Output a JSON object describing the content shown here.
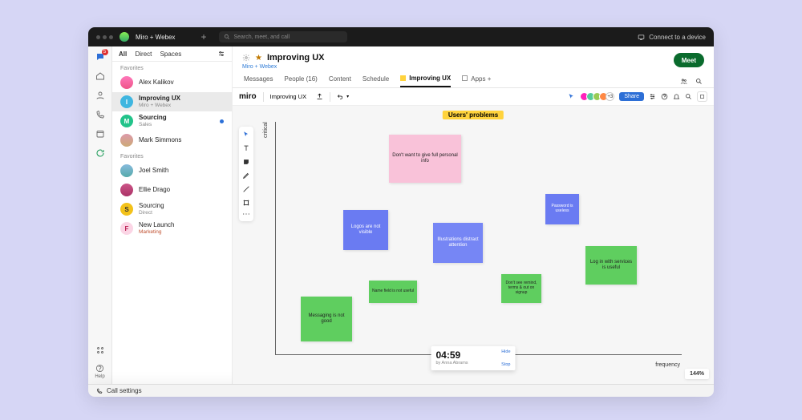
{
  "titlebar": {
    "app_title": "Miro + Webex",
    "search_placeholder": "Search, meet, and call",
    "connect_label": "Connect to a device"
  },
  "rail": {
    "badge": "5",
    "help_label": "Help"
  },
  "sidebar": {
    "tabs": {
      "all": "All",
      "direct": "Direct",
      "spaces": "Spaces"
    },
    "section_a": "Favorites",
    "items_a": [
      {
        "name": "Alex Kalikov"
      },
      {
        "name": "Improving UX",
        "sub": "Miro + Webex"
      },
      {
        "name": "Sourcing",
        "sub": "Sales"
      },
      {
        "name": "Mark Simmons"
      }
    ],
    "section_b": "Favorites",
    "items_b": [
      {
        "name": "Joel Smith"
      },
      {
        "name": "Ellie Drago"
      },
      {
        "name": "Sourcing",
        "sub": "Direct"
      },
      {
        "name": "New Launch",
        "sub": "Marketing"
      }
    ]
  },
  "page": {
    "title": "Improving UX",
    "subtitle": "Miro + Webex",
    "meet": "Meet"
  },
  "ctabs": {
    "messages": "Messages",
    "people": "People (16)",
    "content": "Content",
    "schedule": "Schedule",
    "improving": "Improving UX",
    "apps": "Apps +"
  },
  "miro": {
    "logo": "miro",
    "board_name": "Improving UX",
    "share": "Share",
    "more_av": "+3",
    "title_highlight": "Users' problems",
    "axis_y": "critical",
    "axis_x": "frequency",
    "notes": {
      "n1": "Don't want to give full personal info",
      "n2": "Logos are not visible",
      "n3": "Illustrations distract attention",
      "n4": "Password is useless",
      "n5": "Log in with services is useful",
      "n6": "Name field is not useful",
      "n7": "Don't see remind, terms & out on signup",
      "n8": "Messaging is not good"
    },
    "timer": {
      "time": "04:59",
      "by": "by Anna Abrams",
      "hide": "Hide",
      "stop": "Stop"
    },
    "zoom": "144%"
  },
  "bottom": {
    "call": "Call settings"
  }
}
